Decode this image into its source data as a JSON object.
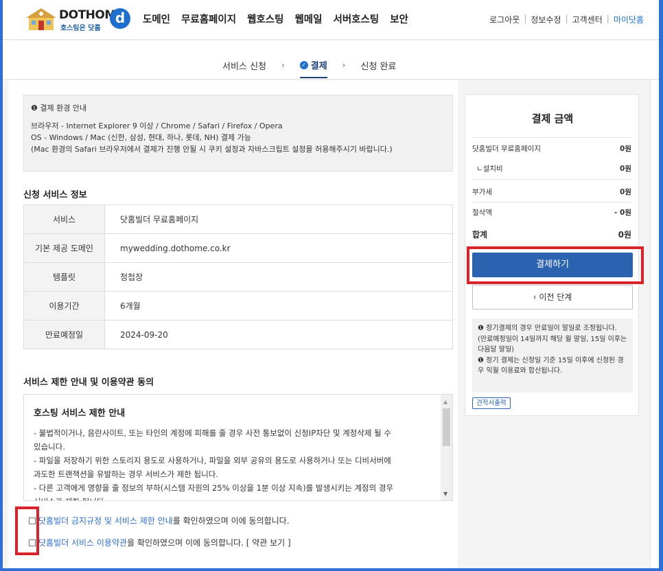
{
  "header": {
    "logo_text": "DOTHOME",
    "logo_sub": "호스팅은 닷홈",
    "logo_mark": "d",
    "nav": [
      "도메인",
      "무료홈페이지",
      "웹호스팅",
      "웹메일",
      "서버호스팅",
      "보안"
    ],
    "util": {
      "logout": "로그아웃",
      "edit_info": "정보수정",
      "support": "고객센터",
      "my_dothome": "마이닷홈"
    }
  },
  "steps": {
    "step1": "서비스 신청",
    "step2": "결제",
    "step3": "신청 완료",
    "arrow": "›"
  },
  "notice": {
    "title": "결제 환경 안내",
    "line1": "브라우저 - Internet Explorer 9 이상 / Chrome / Safari / Firefox / Opera",
    "line2": "OS - Windows / Mac (신한, 삼성, 현대, 하나, 롯데, NH) 결제 가능",
    "line3": "(Mac 환경의 Safari 브라우저에서 결제가 진행 안될 시 쿠키 설정과 자바스크립트 설정을 허용해주시기 바랍니다.)"
  },
  "service_info": {
    "title": "신청 서비스 정보",
    "rows": [
      {
        "label": "서비스",
        "value": "닷홈빌더 무료홈페이지"
      },
      {
        "label": "기본 제공 도메인",
        "value": "mywedding.dothome.co.kr"
      },
      {
        "label": "템플릿",
        "value": "청첩장"
      },
      {
        "label": "이용기간",
        "value": "6개월"
      },
      {
        "label": "만료예정일",
        "value": "2024-09-20"
      }
    ]
  },
  "terms": {
    "title": "서비스 제한 안내 및 이용약관 동의",
    "box_title": "호스팅 서비스 제한 안내",
    "lines": [
      "- 불법적이거나, 음란사이트, 또는 타인의 계정에 피해를 줄 경우 사전 통보없이 신청IP차단 및 계정삭제 될 수",
      "있습니다.",
      "- 파일을 저장하기 위한 스토리지 용도로 사용하거나, 파일을 외부 공유의 용도로 사용하거나 또는 디비서버에",
      "과도한 트랜잭션을 유발하는 경우 서비스가 제한 됩니다.",
      "- 다른 고객에게 영향을 줄 정보의 부하(시스템 자원의 25% 이상을 1분 이상 지속)를 발생시키는 계정의 경우",
      "서비스가 제한 됩니다."
    ],
    "agree1_link": "닷홈빌더 금지규정 및 서비스 제한 안내",
    "agree1_text": "를 확인하였으며 이에 동의합니다.",
    "agree2_link": "닷홈빌더 서비스 이용약관",
    "agree2_text": "을 확인하였으며 이에 동의합니다. [ 약관 보기 ]"
  },
  "payment": {
    "title": "결제 금액",
    "items": [
      {
        "label": "닷홈빌더 무료홈페이지",
        "value": "0원"
      },
      {
        "label": "ㄴ설치비",
        "value": "0원"
      },
      {
        "label": "부가세",
        "value": "0원"
      },
      {
        "label": "절삭액",
        "value": "- 0원"
      }
    ],
    "total_label": "합계",
    "total_value": "0원",
    "pay_button": "결제하기",
    "prev_button": "‹ 이전 단계",
    "note1": "정기결제의 경우 만료일이 말일로 조정됩니다. (만료예정일이 14일까지 해당 월 말일, 15일 이후는 다음달 말일)",
    "note2": "정기 결제는 신청일 기준 15일 이후에 신청된 경우 익월 이용료와 합산됩니다.",
    "quote_button": "견적서출력"
  },
  "colors": {
    "accent": "#2c63b0",
    "highlight_red": "#d9222a",
    "link": "#2e6fd1"
  }
}
